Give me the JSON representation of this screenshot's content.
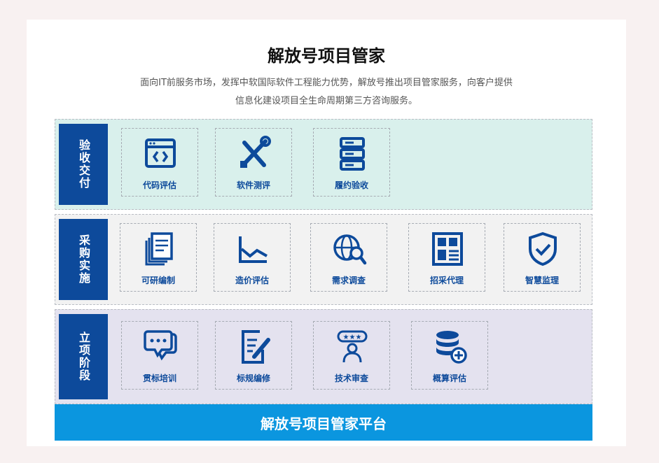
{
  "header": {
    "title": "解放号项目管家",
    "desc_line1": "面向IT前服务市场，发挥中软国际软件工程能力优势，解放号推出项目管家服务，向客户提供",
    "desc_line2": "信息化建设项目全生命周期第三方咨询服务。"
  },
  "layers": [
    {
      "label": "验收交付",
      "items": [
        {
          "label": "代码评估",
          "icon": "code-window-icon"
        },
        {
          "label": "软件测评",
          "icon": "wrench-screwdriver-icon"
        },
        {
          "label": "履约验收",
          "icon": "server-rack-icon"
        }
      ]
    },
    {
      "label": "采购实施",
      "items": [
        {
          "label": "可研编制",
          "icon": "document-stack-icon"
        },
        {
          "label": "造价评估",
          "icon": "line-chart-icon"
        },
        {
          "label": "需求调查",
          "icon": "globe-search-icon"
        },
        {
          "label": "招采代理",
          "icon": "dashboard-grid-icon"
        },
        {
          "label": "智慧监理",
          "icon": "shield-check-icon"
        }
      ]
    },
    {
      "label": "立项阶段",
      "items": [
        {
          "label": "贯标培训",
          "icon": "chat-bubbles-icon"
        },
        {
          "label": "标规编修",
          "icon": "edit-document-icon"
        },
        {
          "label": "技术审查",
          "icon": "rated-person-icon"
        },
        {
          "label": "概算评估",
          "icon": "database-add-icon"
        }
      ]
    }
  ],
  "platform": {
    "label": "解放号项目管家平台"
  },
  "colors": {
    "primary": "#0d4a9b",
    "platform": "#0b96df",
    "layer1": "#d9f0ec",
    "layer2": "#f2f2f2",
    "layer3": "#e4e2ef"
  }
}
